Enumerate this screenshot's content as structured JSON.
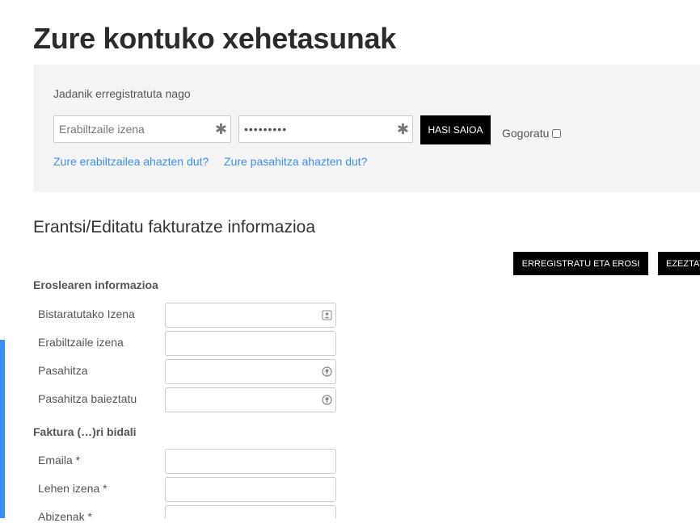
{
  "page": {
    "title": "Zure kontuko xehetasunak"
  },
  "login": {
    "heading": "Jadanik erregistratuta nago",
    "username_placeholder": "Erabiltzaile izena",
    "password_value": "•••••••••",
    "required_mark": "✱",
    "login_button": "HASI SAIOA",
    "remember_label": "Gogoratu",
    "forgot_username": "Zure erabiltzailea ahazten dut?",
    "forgot_password": "Zure pasahitza ahazten dut?"
  },
  "billing": {
    "title": "Erantsi/Editatu fakturatze informazioa",
    "register_button": "ERREGISTRATU ETA EROSI",
    "cancel_button": "EZEZTATU",
    "buyer_group": "Eroslearen informazioa",
    "buyer_fields": [
      {
        "label": "Bistaratutako Izena",
        "icon": "contact-card-icon"
      },
      {
        "label": "Erabiltzaile izena",
        "icon": ""
      },
      {
        "label": "Pasahitza",
        "icon": "key-icon"
      },
      {
        "label": "Pasahitza baieztatu",
        "icon": "key-icon"
      }
    ],
    "send_group": "Faktura (…)ri bidali",
    "send_fields": [
      {
        "label": "Emaila *"
      },
      {
        "label": "Lehen izena *"
      },
      {
        "label": "Abizenak *"
      }
    ]
  },
  "colors": {
    "accent": "#3d8ef0",
    "panel_bg": "#f4f4f4",
    "button_bg": "#000000"
  }
}
